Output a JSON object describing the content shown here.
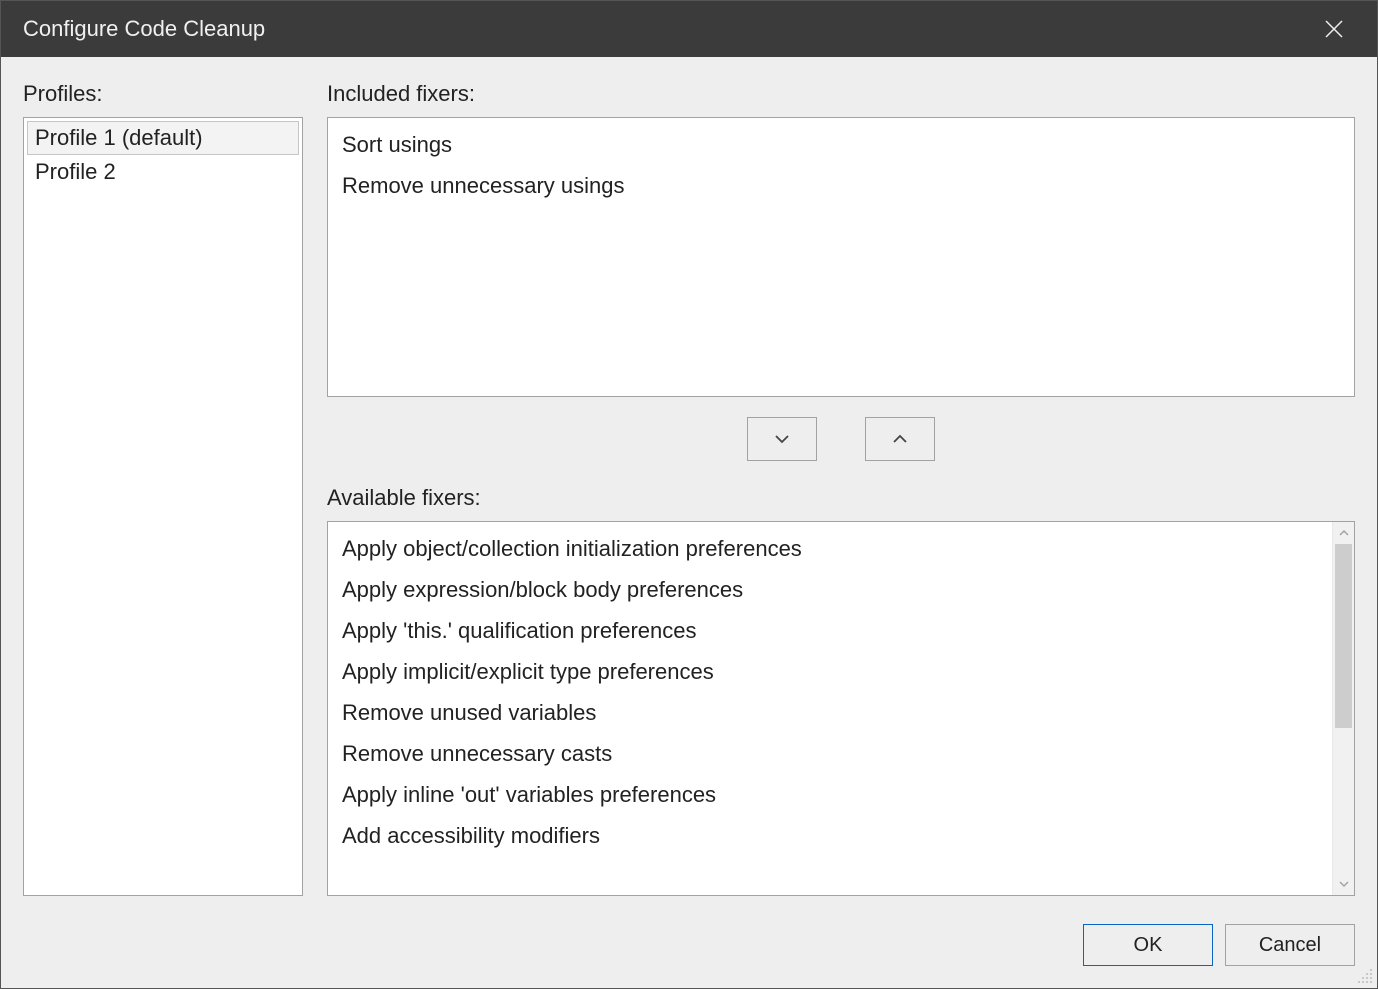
{
  "title": "Configure Code Cleanup",
  "profiles": {
    "label": "Profiles:",
    "items": [
      {
        "label": "Profile 1 (default)",
        "selected": true
      },
      {
        "label": "Profile 2",
        "selected": false
      }
    ]
  },
  "included": {
    "label": "Included fixers:",
    "items": [
      "Sort usings",
      "Remove unnecessary usings"
    ]
  },
  "available": {
    "label": "Available fixers:",
    "items": [
      "Apply object/collection initialization preferences",
      "Apply expression/block body preferences",
      "Apply 'this.' qualification preferences",
      "Apply implicit/explicit type preferences",
      "Remove unused variables",
      "Remove unnecessary casts",
      "Apply inline 'out' variables preferences",
      "Add accessibility modifiers"
    ]
  },
  "buttons": {
    "ok": "OK",
    "cancel": "Cancel"
  }
}
